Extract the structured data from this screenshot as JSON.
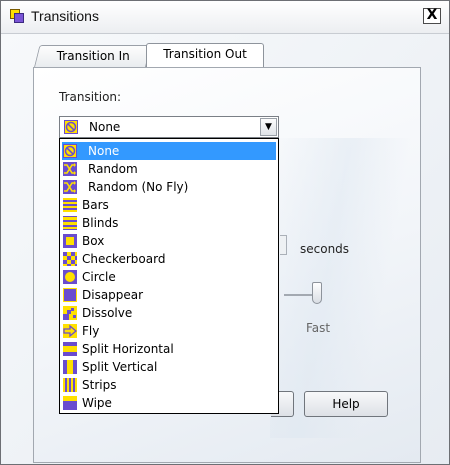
{
  "window": {
    "title": "Transitions",
    "close_label": "X"
  },
  "tabs": [
    {
      "label": "Transition In",
      "selected": false
    },
    {
      "label": "Transition Out",
      "selected": true
    }
  ],
  "transition": {
    "label": "Transition:",
    "selected_value": "None",
    "selected_icon": "none-icon",
    "options": [
      {
        "label": "None",
        "icon": "none-icon",
        "selected": true
      },
      {
        "label": "Random",
        "icon": "shuffle-icon"
      },
      {
        "label": "Random (No Fly)",
        "icon": "shuffle-icon"
      },
      {
        "label": "Bars",
        "icon": "bars-icon"
      },
      {
        "label": "Blinds",
        "icon": "blinds-icon"
      },
      {
        "label": "Box",
        "icon": "box-icon"
      },
      {
        "label": "Checkerboard",
        "icon": "checkerboard-icon"
      },
      {
        "label": "Circle",
        "icon": "circle-icon"
      },
      {
        "label": "Disappear",
        "icon": "disappear-icon"
      },
      {
        "label": "Dissolve",
        "icon": "dissolve-icon"
      },
      {
        "label": "Fly",
        "icon": "fly-arrow-icon"
      },
      {
        "label": "Split Horizontal",
        "icon": "split-horizontal-icon"
      },
      {
        "label": "Split Vertical",
        "icon": "split-vertical-icon"
      },
      {
        "label": "Strips",
        "icon": "strips-icon"
      },
      {
        "label": "Wipe",
        "icon": "wipe-icon"
      }
    ]
  },
  "duration": {
    "unit_label": "seconds"
  },
  "speed": {
    "fast_label": "Fast"
  },
  "buttons": {
    "help_label": "Help"
  },
  "colors": {
    "icon_yellow": "#ffe000",
    "icon_purple": "#6a4ccf",
    "selection": "#3399ff"
  }
}
